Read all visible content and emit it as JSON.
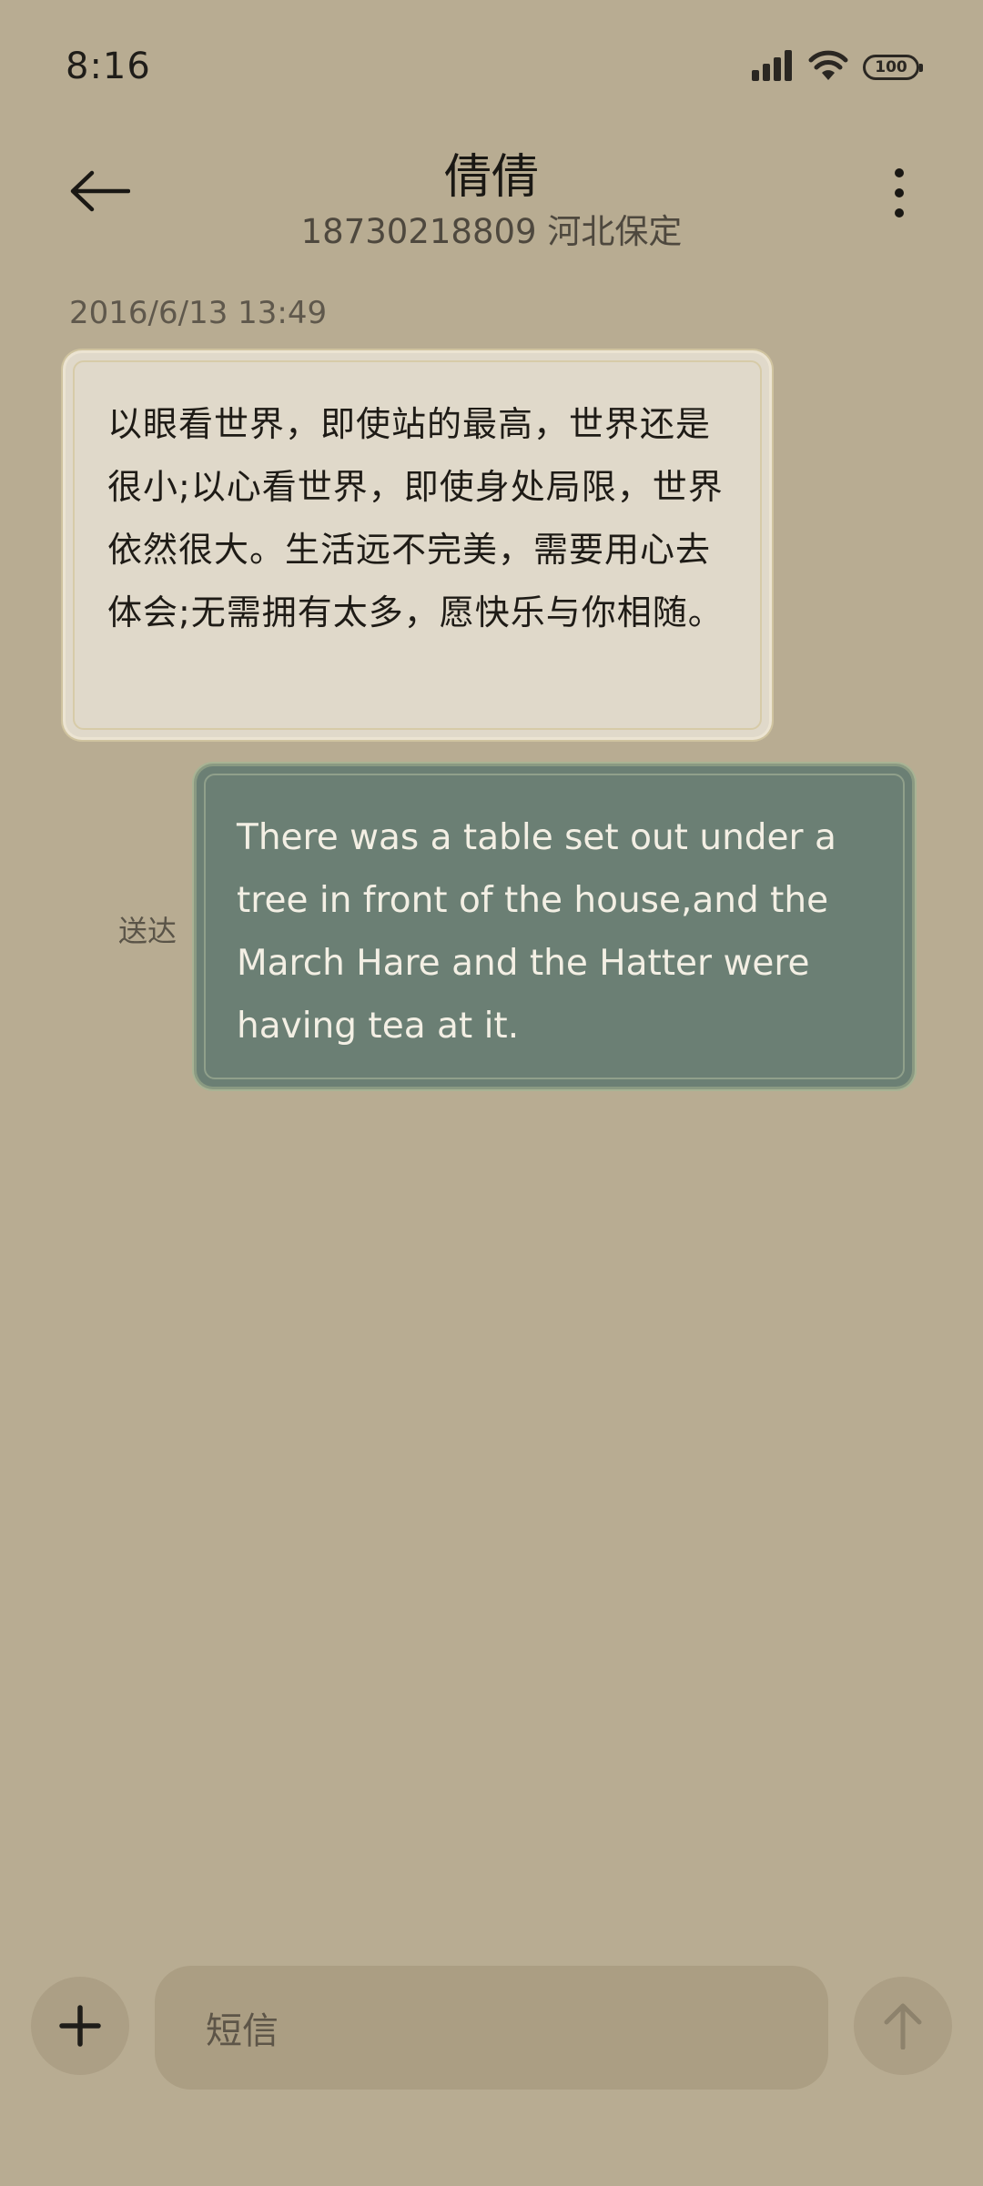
{
  "status_bar": {
    "time": "8:16",
    "battery": "100",
    "icons": [
      "signal-icon",
      "wifi-icon",
      "battery-icon"
    ]
  },
  "header": {
    "back_icon": "arrow-left-icon",
    "title": "倩倩",
    "subtitle": "18730218809 河北保定",
    "menu_icon": "more-vertical-icon"
  },
  "conversation": {
    "timestamp": "2016/6/13 13:49",
    "received_message": "以眼看世界，即使站的最高，世界还是很小;以心看世界，即使身处局限，世界依然很大。生活远不完美，需要用心去体会;无需拥有太多，愿快乐与你相随。",
    "sent_message": "There was a table set out under a tree in front of the house,and the March Hare and the Hatter were having tea at it.",
    "sent_status": "送达"
  },
  "composer": {
    "add_icon": "plus-icon",
    "placeholder": "短信",
    "send_icon": "arrow-up-icon"
  },
  "colors": {
    "background": "#b8ac92",
    "received_bubble": "#e0d9ca",
    "sent_bubble": "#6b7f74"
  }
}
